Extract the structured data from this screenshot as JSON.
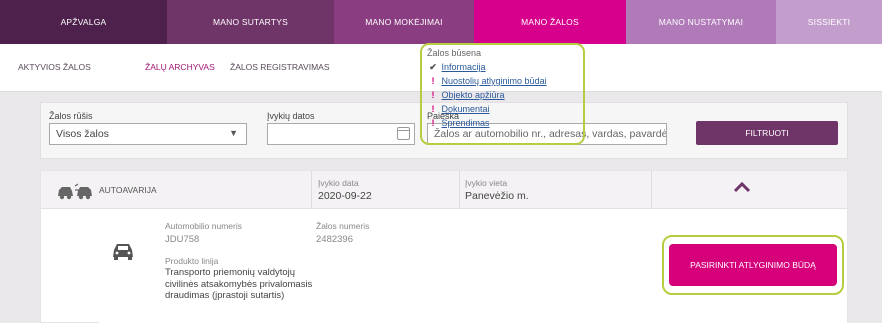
{
  "top_nav": [
    {
      "label": "APŽVALGA"
    },
    {
      "label": "MANO SUTARTYS"
    },
    {
      "label": "MANO MOKĖJIMAI"
    },
    {
      "label": "MANO ŽALOS"
    },
    {
      "label": "MANO NUSTATYMAI"
    },
    {
      "label": "SISSIEKTI"
    }
  ],
  "sub_nav": [
    {
      "label": "AKTYVIOS ŽALOS"
    },
    {
      "label": "ŽALŲ ARCHYVAS"
    },
    {
      "label": "ŽALOS REGISTRAVIMAS"
    }
  ],
  "filter": {
    "type_label": "Žalos rūšis",
    "type_value": "Visos žalos",
    "date_label": "Įvykių datos",
    "date_value": "",
    "search_label": "Paieška",
    "search_placeholder": "Žalos ar automobilio nr., adresas, vardas, pavardė",
    "button_label": "FILTRUOTI"
  },
  "claim": {
    "type": "AUTOAVARIJA",
    "event_date_label": "Įvykio data",
    "event_date": "2020-09-22",
    "event_place_label": "Įvykio vieta",
    "event_place": "Panevėžio m.",
    "car_number_label": "Automobilio numeris",
    "car_number": "JDU758",
    "product_label": "Produkto linija",
    "product_lines": [
      "Transporto priemonių valdytojų",
      "civilinės atsakomybės privalomasis",
      "draudimas (įprastoji sutartis)"
    ],
    "claim_number_label": "Žalos numeris",
    "claim_number": "2482396",
    "status_label": "Žalos būsena",
    "status_steps": [
      {
        "label": "Informacija",
        "mark": "✔"
      },
      {
        "label": "Nuostolių atlyginimo būdai",
        "mark": "!"
      },
      {
        "label": "Objekto apžiūra",
        "mark": "!"
      },
      {
        "label": "Dokumentai",
        "mark": "!"
      },
      {
        "label": "Sprendimas",
        "mark": "!"
      }
    ],
    "choose_button": "PASIRINKTI ATLYGINIMO BŪDĄ"
  },
  "colors": {
    "active_tab": "#d6008c",
    "button_purple": "#6f3468",
    "highlight": "#b8cc3f"
  }
}
